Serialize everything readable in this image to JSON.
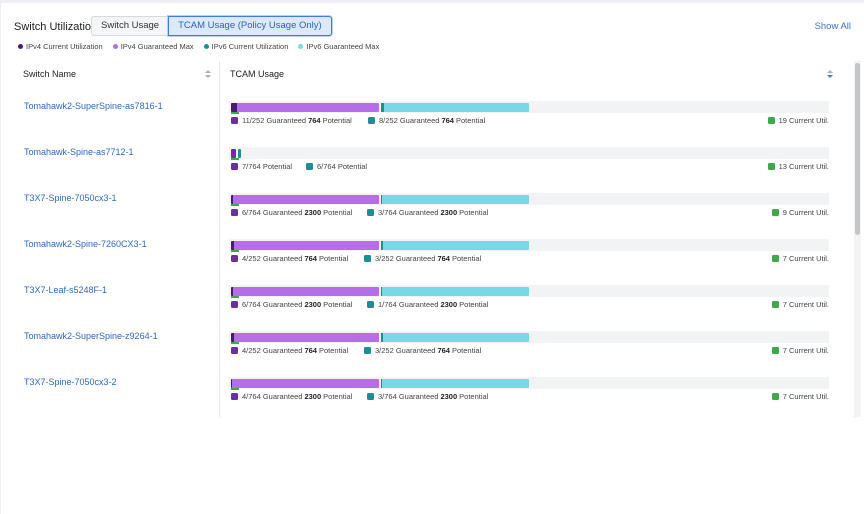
{
  "header": {
    "title": "Switch Utilization",
    "tabs": [
      {
        "label": "Switch Usage",
        "active": false
      },
      {
        "label": "TCAM Usage (Policy Usage Only)",
        "active": true
      }
    ],
    "show_all": "Show All"
  },
  "legend": [
    {
      "label": "IPv4 Current Utilization",
      "color": "#4b1a72"
    },
    {
      "label": "IPv4 Guaranteed Max",
      "color": "#b56ee8"
    },
    {
      "label": "IPv6 Current Utilization",
      "color": "#1f8c98"
    },
    {
      "label": "IPv6 Guaranteed Max",
      "color": "#78d8e6"
    }
  ],
  "table": {
    "col_switch": "Switch Name",
    "col_tcam": "TCAM Usage",
    "rows": [
      {
        "name": "Tomahawk2-SuperSpine-as7816-1",
        "v4": "11/252 Guaranteed",
        "v4n": "764",
        "v4p": "Potential",
        "v6": "8/252 Guaranteed",
        "v6n": "764",
        "v6p": "Potential",
        "curr": "19 Current Util."
      },
      {
        "name": "Tomahawk-Spine-as7712-1",
        "v4": "7/764 Potential",
        "v6": "6/764 Potential",
        "curr": "13 Current Util."
      },
      {
        "name": "T3X7-Spine-7050cx3-1",
        "v4": "6/764 Guaranteed",
        "v4n": "2300",
        "v4p": "Potential",
        "v6": "3/764 Guaranteed",
        "v6n": "2300",
        "v6p": "Potential",
        "curr": "9 Current Util."
      },
      {
        "name": "Tomahawk2-Spine-7260CX3-1",
        "v4": "4/252 Guaranteed",
        "v4n": "764",
        "v4p": "Potential",
        "v6": "3/252 Guaranteed",
        "v6n": "764",
        "v6p": "Potential",
        "curr": "7 Current Util."
      },
      {
        "name": "T3X7-Leaf-s5248F-1",
        "v4": "6/764 Guaranteed",
        "v4n": "2300",
        "v4p": "Potential",
        "v6": "1/764 Guaranteed",
        "v6n": "2300",
        "v6p": "Potential",
        "curr": "7 Current Util."
      },
      {
        "name": "Tomahawk2-SuperSpine-z9264-1",
        "v4": "4/252 Guaranteed",
        "v4n": "764",
        "v4p": "Potential",
        "v6": "3/252 Guaranteed",
        "v6n": "764",
        "v6p": "Potential",
        "curr": "7 Current Util."
      },
      {
        "name": "T3X7-Spine-7050cx3-2",
        "v4": "4/764 Guaranteed",
        "v4n": "2300",
        "v4p": "Potential",
        "v6": "3/764 Guaranteed",
        "v6n": "2300",
        "v6p": "Potential",
        "curr": "7 Current Util."
      }
    ]
  },
  "colors": {
    "current_util": "#3aaa4a",
    "link": "#2f68c4"
  }
}
